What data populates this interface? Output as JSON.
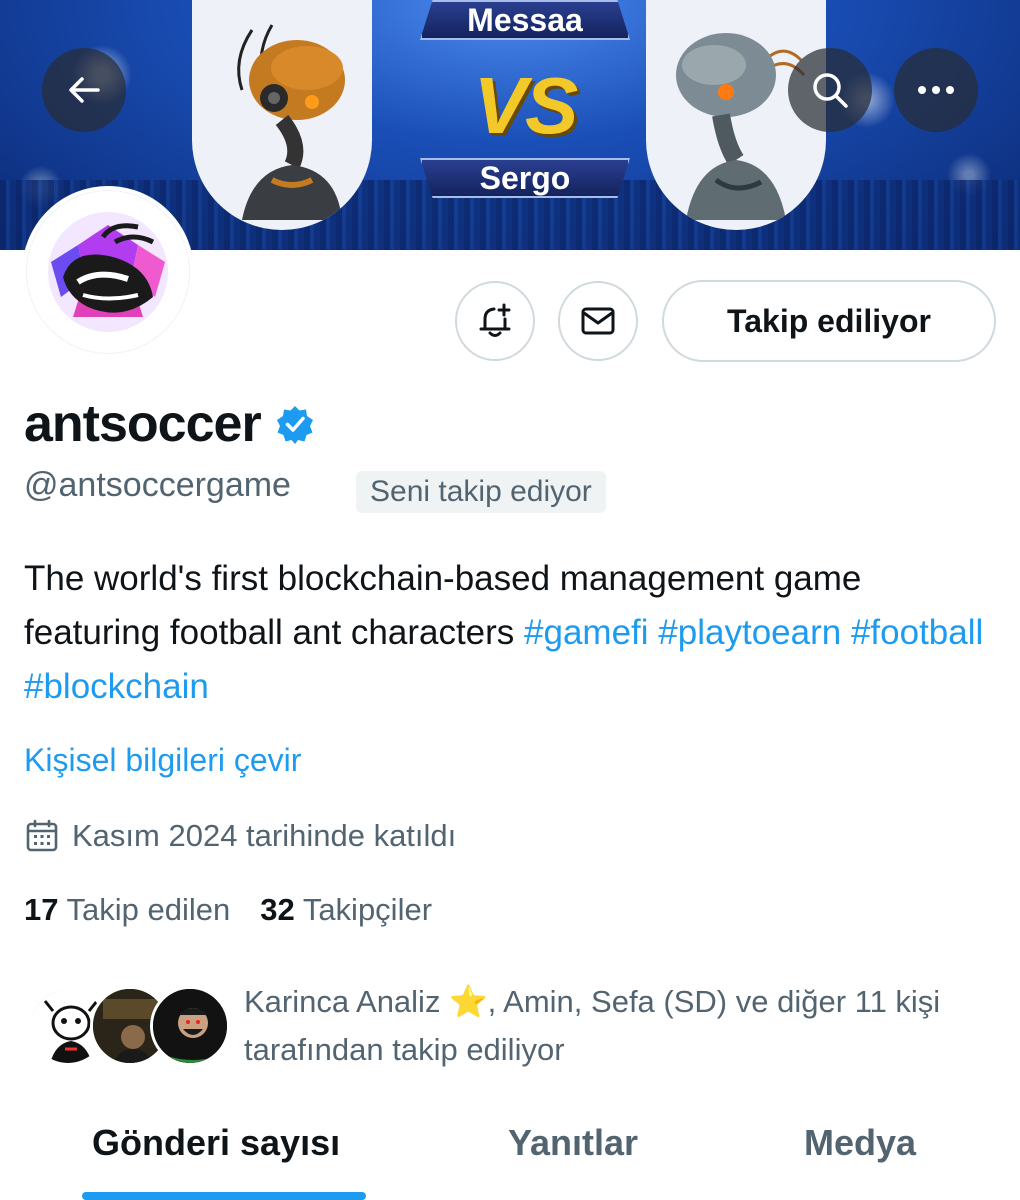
{
  "banner": {
    "player_top": "Messaa",
    "vs": "VS",
    "player_bottom": "Sergo"
  },
  "header": {
    "back_icon": "arrow-left-icon",
    "search_icon": "search-icon",
    "more_icon": "more-horizontal-icon"
  },
  "actions": {
    "notify_icon": "bell-plus-icon",
    "message_icon": "mail-icon",
    "follow_label": "Takip ediliyor"
  },
  "profile": {
    "display_name": "antsoccer",
    "verified_icon": "verified-badge-icon",
    "handle": "@antsoccergame",
    "follows_you": "Seni takip ediyor",
    "bio_text": "The world's first blockchain-based management game featuring football ant characters",
    "bio_tags": [
      "#gamefi",
      "#playtoearn",
      "#football",
      "#blockchain"
    ],
    "translate_label": "Kişisel bilgileri çevir",
    "calendar_icon": "calendar-icon",
    "joined": "Kasım 2024 tarihinde katıldı"
  },
  "stats": {
    "following_count": "17",
    "following_label": "Takip edilen",
    "followers_count": "32",
    "followers_label": "Takipçiler"
  },
  "followed_by": {
    "text": "Karinca Analiz ⭐️, Amin, Sefa (SD) ve diğer 11 kişi tarafından takip ediliyor"
  },
  "tabs": [
    {
      "label": "Gönderi sayısı",
      "active": true
    },
    {
      "label": "Yanıtlar",
      "active": false
    },
    {
      "label": "Medya",
      "active": false
    }
  ],
  "colors": {
    "accent": "#1d9bf0",
    "text": "#0f1419",
    "secondary": "#536471"
  }
}
